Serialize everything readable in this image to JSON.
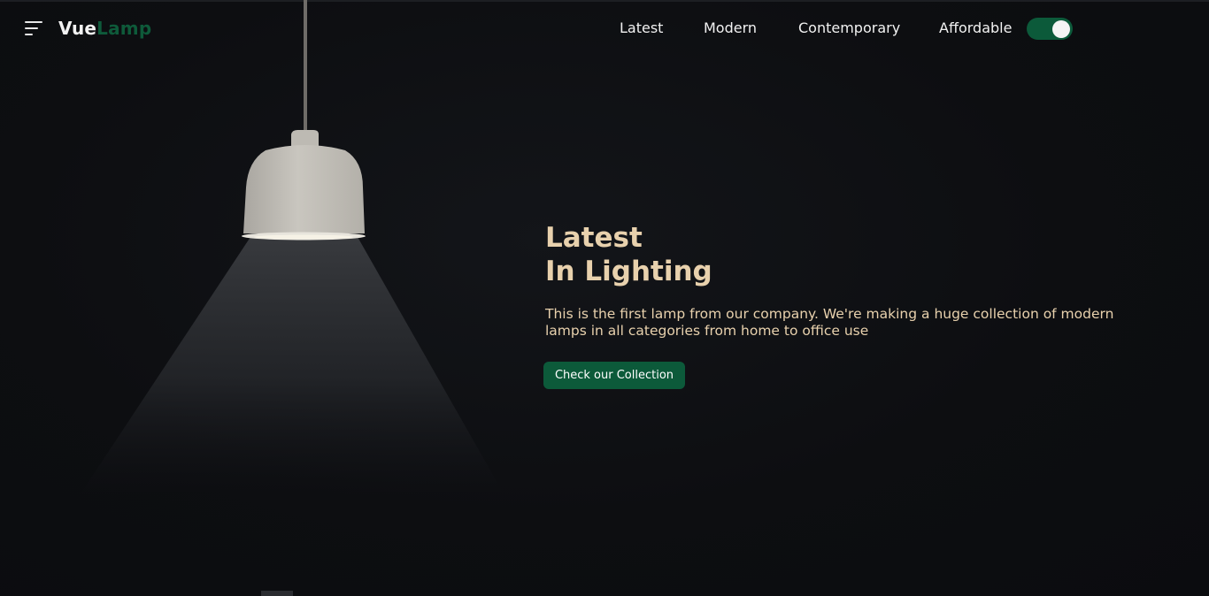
{
  "header": {
    "logo_part1": "Vue",
    "logo_part2": "Lamp",
    "nav": [
      "Latest",
      "Modern",
      "Contemporary",
      "Affordable"
    ],
    "toggle_on": true
  },
  "hero": {
    "title_line1": "Latest",
    "title_line2": "In Lighting",
    "description": "This is the first lamp from our company. We're making a huge collection of modern lamps in all categories from home to office use",
    "cta_label": "Check our Collection"
  },
  "colors": {
    "background": "#0d0e11",
    "accent_green": "#0c5a3a",
    "hero_text": "#e8d1ad",
    "nav_text": "#f2f2f2"
  }
}
